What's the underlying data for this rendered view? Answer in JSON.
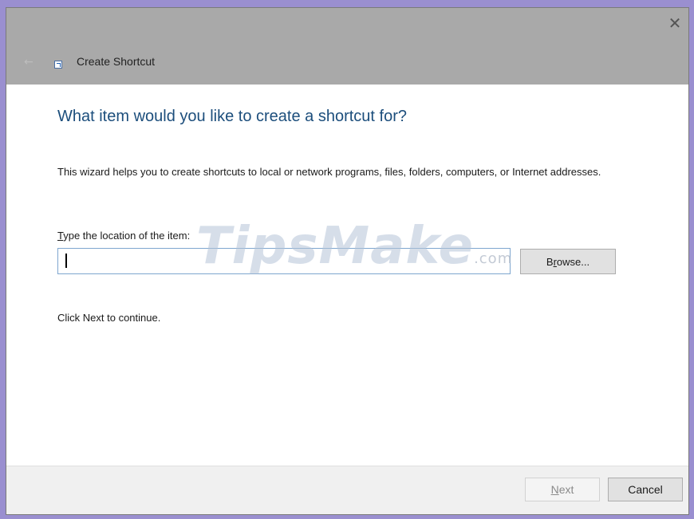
{
  "window": {
    "title": "Create Shortcut",
    "close_glyph": "✕",
    "back_glyph": "←"
  },
  "content": {
    "heading": "What item would you like to create a shortcut for?",
    "description": "This wizard helps you to create shortcuts to local or network programs, files, folders, computers, or Internet addresses.",
    "field_label_access_key": "T",
    "field_label_rest": "ype the location of the item:",
    "location_value": "",
    "browse_access_key": "r",
    "browse_prefix": "B",
    "browse_suffix": "owse...",
    "hint": "Click Next to continue."
  },
  "watermark": {
    "brand": "TipsMake",
    "suffix": ".com"
  },
  "footer": {
    "next_access_key": "N",
    "next_rest": "ext",
    "next_enabled": false,
    "cancel_label": "Cancel"
  },
  "colors": {
    "titlebar": "#a9a9a9",
    "heading": "#1c4e7c",
    "input_border": "#7ea6cf"
  }
}
